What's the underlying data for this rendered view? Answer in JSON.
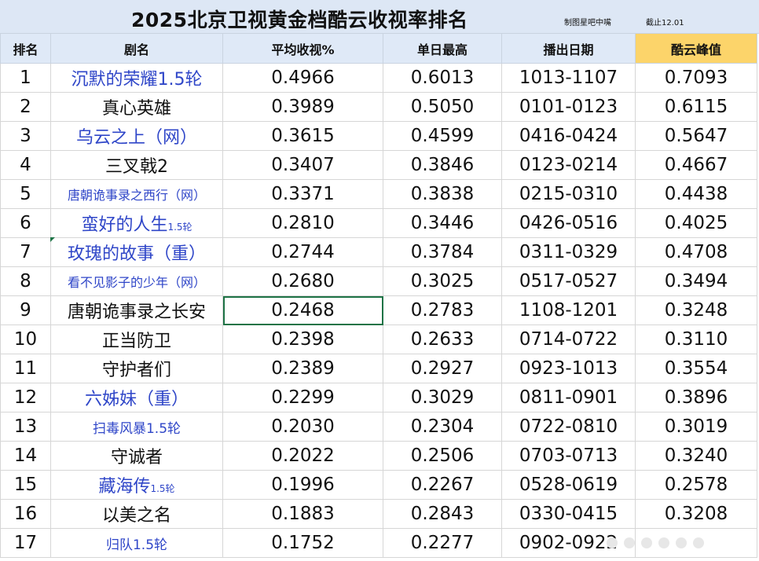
{
  "header": {
    "title": "2025北京卫视黄金档酷云收视率排名",
    "maker": "制图星吧中嘴",
    "cutoff": "截止12.01"
  },
  "columns": [
    "排名",
    "剧名",
    "平均收视%",
    "单日最高",
    "播出日期",
    "酷云峰值"
  ],
  "rows": [
    {
      "rank": "1",
      "name": "沉默的荣耀1.5轮",
      "name_suffix": "",
      "avg": "0.4966",
      "max": "0.6013",
      "dates": "1013-1107",
      "peak": "0.7093",
      "style": "blue"
    },
    {
      "rank": "2",
      "name": "真心英雄",
      "name_suffix": "",
      "avg": "0.3989",
      "max": "0.5050",
      "dates": "0101-0123",
      "peak": "0.6115",
      "style": "black"
    },
    {
      "rank": "3",
      "name": "乌云之上（网）",
      "name_suffix": "",
      "avg": "0.3615",
      "max": "0.4599",
      "dates": "0416-0424",
      "peak": "0.5647",
      "style": "blue"
    },
    {
      "rank": "4",
      "name": "三叉戟2",
      "name_suffix": "",
      "avg": "0.3407",
      "max": "0.3846",
      "dates": "0123-0214",
      "peak": "0.4667",
      "style": "black"
    },
    {
      "rank": "5",
      "name": "唐朝诡事录之西行（网）",
      "name_suffix": "",
      "avg": "0.3371",
      "max": "0.3838",
      "dates": "0215-0310",
      "peak": "0.4438",
      "style": "blue-small"
    },
    {
      "rank": "6",
      "name": "蛮好的人生",
      "name_suffix": "1.5轮",
      "avg": "0.2810",
      "max": "0.3446",
      "dates": "0426-0516",
      "peak": "0.4025",
      "style": "blue"
    },
    {
      "rank": "7",
      "name": "玫瑰的故事（重）",
      "name_suffix": "",
      "avg": "0.2744",
      "max": "0.3784",
      "dates": "0311-0329",
      "peak": "0.4708",
      "style": "blue"
    },
    {
      "rank": "8",
      "name": "看不见影子的少年（网）",
      "name_suffix": "",
      "avg": "0.2680",
      "max": "0.3025",
      "dates": "0517-0527",
      "peak": "0.3494",
      "style": "blue-small"
    },
    {
      "rank": "9",
      "name": "唐朝诡事录之长安",
      "name_suffix": "",
      "avg": "0.2468",
      "max": "0.2783",
      "dates": "1108-1201",
      "peak": "0.3248",
      "style": "black"
    },
    {
      "rank": "10",
      "name": "正当防卫",
      "name_suffix": "",
      "avg": "0.2398",
      "max": "0.2633",
      "dates": "0714-0722",
      "peak": "0.3110",
      "style": "black"
    },
    {
      "rank": "11",
      "name": "守护者们",
      "name_suffix": "",
      "avg": "0.2389",
      "max": "0.2927",
      "dates": "0923-1013",
      "peak": "0.3554",
      "style": "black"
    },
    {
      "rank": "12",
      "name": "六姊妹（重）",
      "name_suffix": "",
      "avg": "0.2299",
      "max": "0.3029",
      "dates": "0811-0901",
      "peak": "0.3896",
      "style": "blue"
    },
    {
      "rank": "13",
      "name": "扫毒风暴1.5轮",
      "name_suffix": "",
      "avg": "0.2030",
      "max": "0.2304",
      "dates": "0722-0810",
      "peak": "0.3019",
      "style": "blue-tiny"
    },
    {
      "rank": "14",
      "name": "守诚者",
      "name_suffix": "",
      "avg": "0.2022",
      "max": "0.2506",
      "dates": "0703-0713",
      "peak": "0.3240",
      "style": "black"
    },
    {
      "rank": "15",
      "name": "藏海传",
      "name_suffix": "1.5轮",
      "avg": "0.1996",
      "max": "0.2267",
      "dates": "0528-0619",
      "peak": "0.2578",
      "style": "blue"
    },
    {
      "rank": "16",
      "name": "以美之名",
      "name_suffix": "",
      "avg": "0.1883",
      "max": "0.2843",
      "dates": "0330-0415",
      "peak": "0.3208",
      "style": "black"
    },
    {
      "rank": "17",
      "name": "归队1.5轮",
      "name_suffix": "",
      "avg": "0.1752",
      "max": "0.2277",
      "dates": "0902-0922",
      "peak": "",
      "style": "blue-tiny"
    }
  ],
  "colors": {
    "blue_text": "#2f46c8",
    "header_bg": "#dfe9f7",
    "peak_header_bg": "#fcd46a",
    "selection": "#1e7346"
  }
}
